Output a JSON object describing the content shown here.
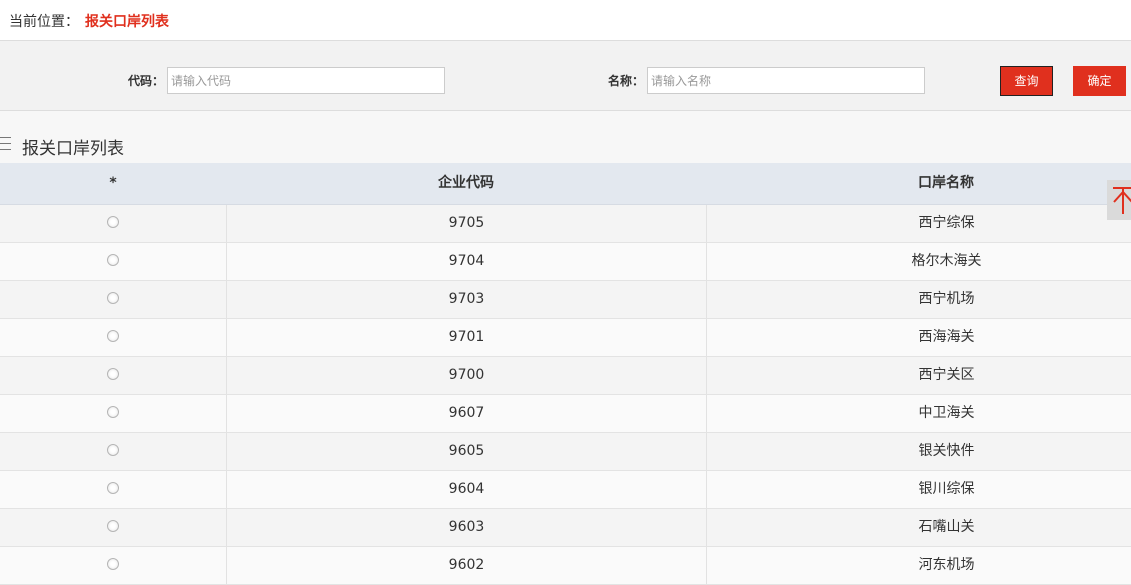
{
  "breadcrumb": {
    "label": "当前位置：",
    "current": "报关口岸列表"
  },
  "search": {
    "code_label": "代码：",
    "code_placeholder": "请输入代码",
    "name_label": "名称：",
    "name_placeholder": "请输入名称",
    "query_button": "查询",
    "confirm_button": "确定"
  },
  "section": {
    "title": "报关口岸列表",
    "icon": "menu-icon"
  },
  "table": {
    "columns": [
      "*",
      "企业代码",
      "口岸名称"
    ],
    "rows": [
      {
        "code": "9705",
        "name": "西宁综保"
      },
      {
        "code": "9704",
        "name": "格尔木海关"
      },
      {
        "code": "9703",
        "name": "西宁机场"
      },
      {
        "code": "9701",
        "name": "西海海关"
      },
      {
        "code": "9700",
        "name": "西宁关区"
      },
      {
        "code": "9607",
        "name": "中卫海关"
      },
      {
        "code": "9605",
        "name": "银关快件"
      },
      {
        "code": "9604",
        "name": "银川综保"
      },
      {
        "code": "9603",
        "name": "石嘴山关"
      },
      {
        "code": "9602",
        "name": "河东机场"
      }
    ]
  },
  "colors": {
    "accent": "#e0301e",
    "header_bg": "#e3e8ef"
  },
  "back_to_top": {
    "icon": "arrow-up-icon"
  }
}
